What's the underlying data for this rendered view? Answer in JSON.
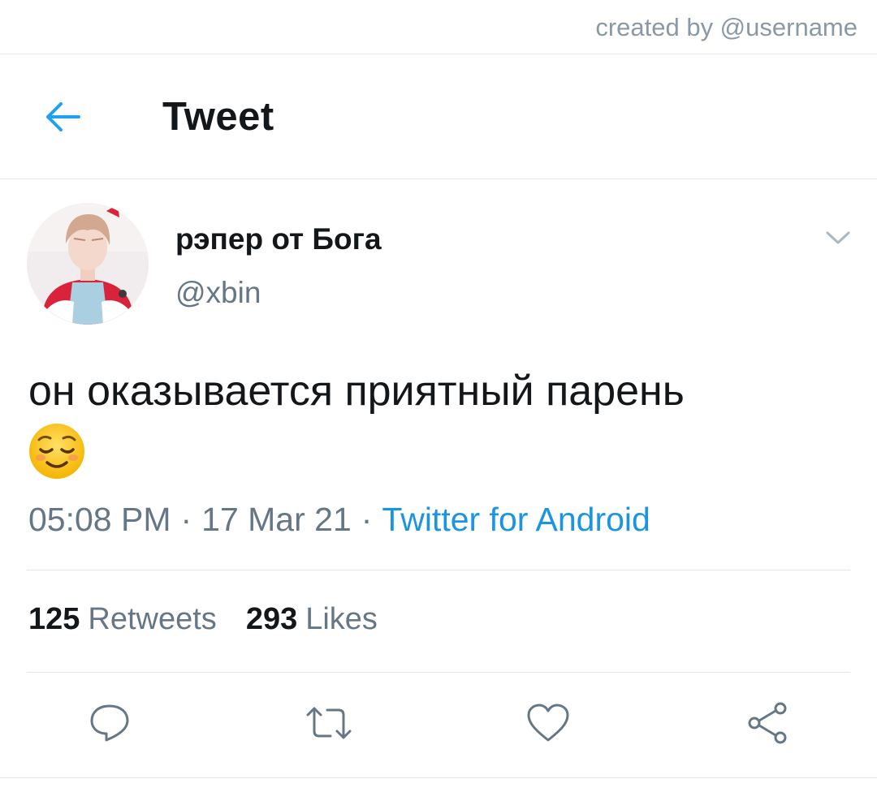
{
  "watermark": "created by @username",
  "header": {
    "title": "Tweet",
    "back_icon": "arrow-left-icon",
    "accent": "#1da1f2"
  },
  "tweet": {
    "author_name": "рэпер от Бога",
    "author_handle": "@xbin",
    "text": "он оказывается приятный парень",
    "emoji": "relieved-face-emoji",
    "time": "05:08 PM",
    "date": "17 Mar 21",
    "source": "Twitter for Android",
    "separator": "·"
  },
  "stats": {
    "retweets_count": "125",
    "retweets_label": "Retweets",
    "likes_count": "293",
    "likes_label": "Likes"
  },
  "actions": [
    "reply-icon",
    "retweet-icon",
    "like-icon",
    "share-icon"
  ],
  "colors": {
    "text": "#14171a",
    "secondary": "#657786",
    "link": "#1b95e0",
    "divider": "#e1e8ed"
  }
}
